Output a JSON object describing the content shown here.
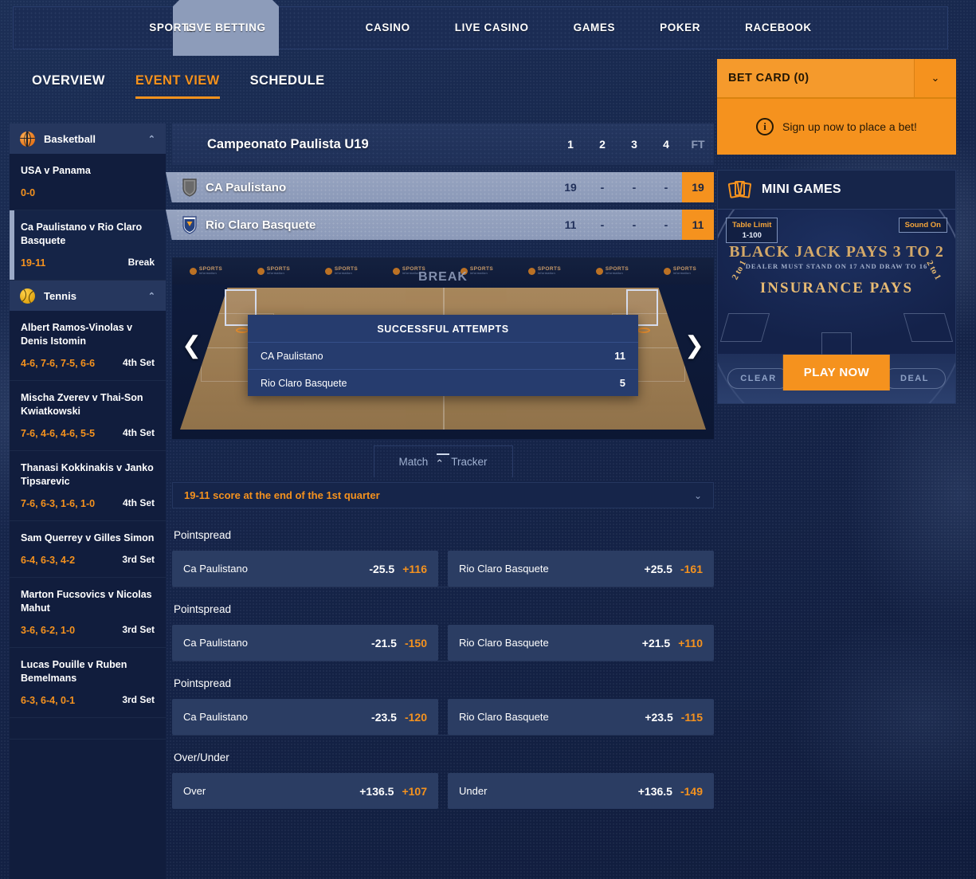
{
  "topnav": {
    "items": [
      {
        "label": "SPORTS",
        "active": false
      },
      {
        "label": "LIVE BETTING",
        "active": true
      },
      {
        "label": "CASINO",
        "active": false
      },
      {
        "label": "LIVE CASINO",
        "active": false
      },
      {
        "label": "GAMES",
        "active": false
      },
      {
        "label": "POKER",
        "active": false
      },
      {
        "label": "RACEBOOK",
        "active": false
      }
    ]
  },
  "subnav": {
    "items": [
      {
        "label": "OVERVIEW"
      },
      {
        "label": "EVENT VIEW"
      },
      {
        "label": "SCHEDULE"
      }
    ],
    "active_index": 1
  },
  "sidebar": {
    "groups": [
      {
        "sport": "Basketball",
        "icon": "basketball-icon",
        "collapse_caret": "⌃",
        "events": [
          {
            "title": "USA v Panama",
            "score": "0-0",
            "status": "",
            "selected": false
          },
          {
            "title": "Ca Paulistano v Rio Claro Basquete",
            "score": "19-11",
            "status": "Break",
            "selected": true
          }
        ]
      },
      {
        "sport": "Tennis",
        "icon": "tennis-ball-icon",
        "collapse_caret": "⌃",
        "events": [
          {
            "title": "Albert Ramos-Vinolas v Denis Istomin",
            "score": "4-6, 7-6, 7-5, 6-6",
            "status": "4th Set",
            "selected": false
          },
          {
            "title": "Mischa Zverev v Thai-Son Kwiatkowski",
            "score": "7-6, 4-6, 4-6, 5-5",
            "status": "4th Set",
            "selected": false
          },
          {
            "title": "Thanasi Kokkinakis v Janko Tipsarevic",
            "score": "7-6, 6-3, 1-6, 1-0",
            "status": "4th Set",
            "selected": false
          },
          {
            "title": "Sam Querrey v Gilles Simon",
            "score": "6-4, 6-3, 4-2",
            "status": "3rd Set",
            "selected": false
          },
          {
            "title": "Marton Fucsovics v Nicolas Mahut",
            "score": "3-6, 6-2, 1-0",
            "status": "3rd Set",
            "selected": false
          },
          {
            "title": "Lucas Pouille v Ruben Bemelmans",
            "score": "6-3, 6-4, 0-1",
            "status": "3rd Set",
            "selected": false
          }
        ]
      }
    ]
  },
  "scoreboard": {
    "league": "Campeonato Paulista U19",
    "period_headers": [
      "1",
      "2",
      "3",
      "4",
      "FT"
    ],
    "teams": [
      {
        "name": "CA Paulistano",
        "badge": "shield-grey-icon",
        "periods": [
          "19",
          "-",
          "-",
          "-"
        ],
        "total": "19"
      },
      {
        "name": "Rio Claro Basquete",
        "badge": "shield-blue-icon",
        "periods": [
          "11",
          "-",
          "-",
          "-"
        ],
        "total": "11"
      }
    ]
  },
  "tracker": {
    "break_label": "BREAK",
    "ad_banner": {
      "line1": "SPORTS",
      "line2": "information"
    },
    "ad_count": 8,
    "prev_arrow": "❮",
    "next_arrow": "❯",
    "stats_title": "SUCCESSFUL ATTEMPTS",
    "stats_rows": [
      {
        "label": "CA Paulistano",
        "value": "11"
      },
      {
        "label": "Rio Claro Basquete",
        "value": "5"
      }
    ],
    "toggle": {
      "left_label": "Match",
      "right_label": "Tracker",
      "chevron": "⌃"
    }
  },
  "status_strip": {
    "text": "19-11 score at the end of the 1st quarter",
    "chevron": "⌄"
  },
  "markets": [
    {
      "title": "Pointspread",
      "outcomes": [
        {
          "name": "Ca Paulistano",
          "line": "-25.5",
          "price": "+116"
        },
        {
          "name": "Rio Claro Basquete",
          "line": "+25.5",
          "price": "-161"
        }
      ]
    },
    {
      "title": "Pointspread",
      "outcomes": [
        {
          "name": "Ca Paulistano",
          "line": "-21.5",
          "price": "-150"
        },
        {
          "name": "Rio Claro Basquete",
          "line": "+21.5",
          "price": "+110"
        }
      ]
    },
    {
      "title": "Pointspread",
      "outcomes": [
        {
          "name": "Ca Paulistano",
          "line": "-23.5",
          "price": "-120"
        },
        {
          "name": "Rio Claro Basquete",
          "line": "+23.5",
          "price": "-115"
        }
      ]
    },
    {
      "title": "Over/Under",
      "outcomes": [
        {
          "name": "Over",
          "line": "+136.5",
          "price": "+107"
        },
        {
          "name": "Under",
          "line": "+136.5",
          "price": "-149"
        }
      ]
    }
  ],
  "bet_card": {
    "title": "BET CARD (0)",
    "toggle_icon": "⌄",
    "info_icon": "i",
    "message": "Sign up now to place a bet!"
  },
  "mini_games": {
    "title": "MINI GAMES",
    "icon": "playing-cards-icon",
    "table_limit_label": "Table Limit",
    "table_limit_value": "1-100",
    "sound_label": "Sound On",
    "felt_line_1": "BLACK JACK PAYS 3 TO 2",
    "felt_line_2": "DEALER MUST STAND ON 17 AND DRAW TO 16",
    "felt_line_3": "INSURANCE PAYS",
    "side_odds": "2 to 1",
    "clear_label": "CLEAR",
    "deal_label": "DEAL",
    "play_label": "PLAY NOW"
  },
  "colors": {
    "accent_orange": "#f5921e",
    "page_bg": "#0d1733",
    "panel_bg": "#16254a",
    "outcome_bg": "#2b3d63",
    "team_row": "#8f9cbb"
  }
}
